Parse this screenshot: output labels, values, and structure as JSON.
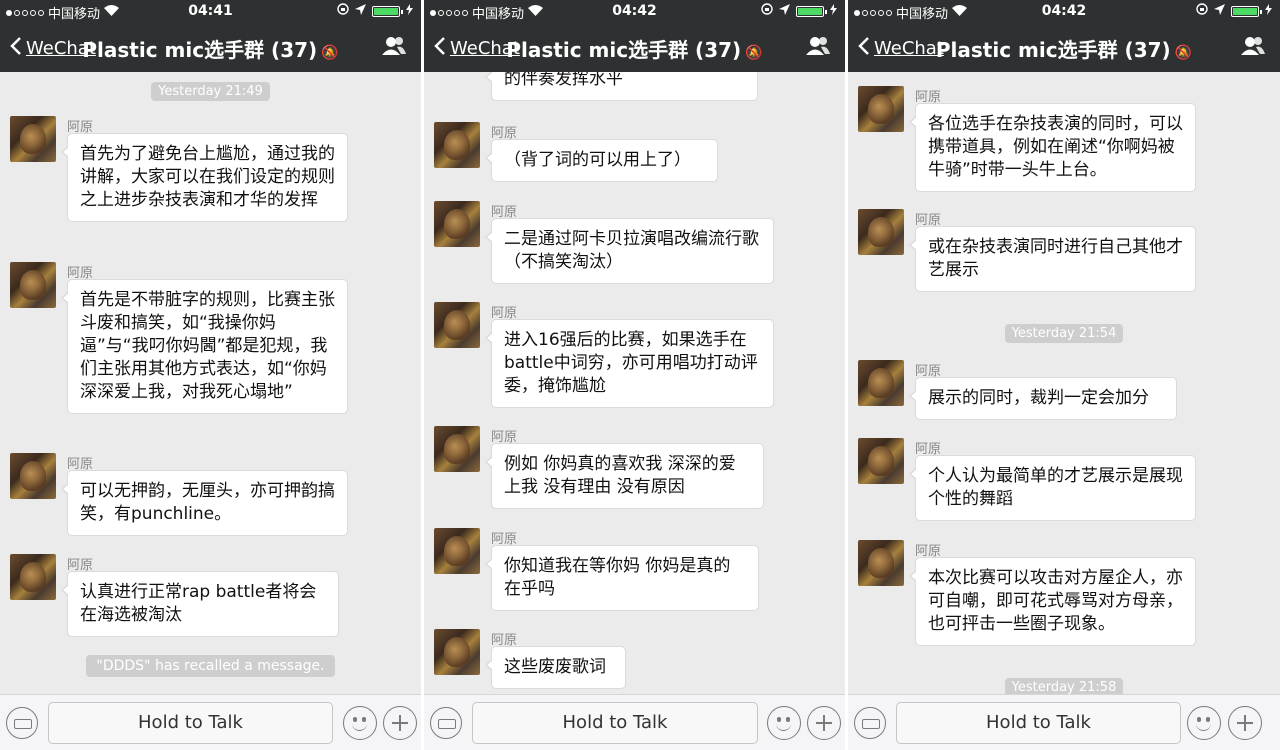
{
  "status": {
    "carrier": "中国移动",
    "times": [
      "04:41",
      "04:42",
      "04:42"
    ]
  },
  "nav": {
    "back_label": "WeChat",
    "title": "Plastic mic选手群 (37)"
  },
  "bottom": {
    "talk_label": "Hold to Talk"
  },
  "panels": [
    {
      "timestamps": [
        "Yesterday 21:49"
      ],
      "messages": [
        {
          "sender": "阿原",
          "text": "首先为了避免台上尴尬，通过我的讲解，大家可以在我们设定的规则之上进步杂技表演和才华的发挥"
        },
        {
          "sender": "阿原",
          "text": " 首先是不带脏字的规则，比赛主张斗废和搞笑，如“我操你妈逼”与“我叼你妈閪”都是犯规，我们主张用其他方式表达，如“你妈深深爱上我，对我死心塌地”"
        },
        {
          "sender": "阿原",
          "text": "可以无押韵，无厘头，亦可押韵搞笑，有punchline。"
        },
        {
          "sender": "阿原",
          "text": " 认真进行正常rap battle者将会在海选被淘汰"
        }
      ],
      "recall": "\"DDDS\" has recalled a message."
    },
    {
      "partial": "的伴奏发挥水平",
      "messages": [
        {
          "sender": "阿原",
          "text": "（背了词的可以用上了）"
        },
        {
          "sender": "阿原",
          "text": "二是通过阿卡贝拉演唱改编流行歌（不搞笑淘汰）"
        },
        {
          "sender": "阿原",
          "text": "进入16强后的比赛，如果选手在battle中词穷，亦可用唱功打动评委，掩饰尴尬"
        },
        {
          "sender": "阿原",
          "text": "例如 你妈真的喜欢我 深深的爱上我 没有理由 没有原因"
        },
        {
          "sender": "阿原",
          "text": "你知道我在等你妈 你妈是真的在乎吗"
        },
        {
          "sender": "阿原",
          "text": "这些废废歌词"
        }
      ]
    },
    {
      "timestamps": [
        "Yesterday 21:54",
        "Yesterday 21:58"
      ],
      "messages": [
        {
          "sender": "阿原",
          "text": "各位选手在杂技表演的同时，可以携带道具，例如在阐述“你啊妈被牛骑”时带一头牛上台。"
        },
        {
          "sender": "阿原",
          "text": "或在杂技表演同时进行自己其他才艺展示"
        },
        {
          "sender": "阿原",
          "text": "展示的同时，裁判一定会加分"
        },
        {
          "sender": "阿原",
          "text": "个人认为最简单的才艺展示是展现个性的舞蹈"
        },
        {
          "sender": "阿原",
          "text": "本次比赛可以攻击对方屋企人，亦可自嘲，即可花式辱骂对方母亲，也可抨击一些圈子现象。"
        }
      ]
    }
  ],
  "colors": {
    "nav_bg": "#2e3132",
    "chat_bg": "#ebebeb",
    "battery": "#4cd964"
  }
}
